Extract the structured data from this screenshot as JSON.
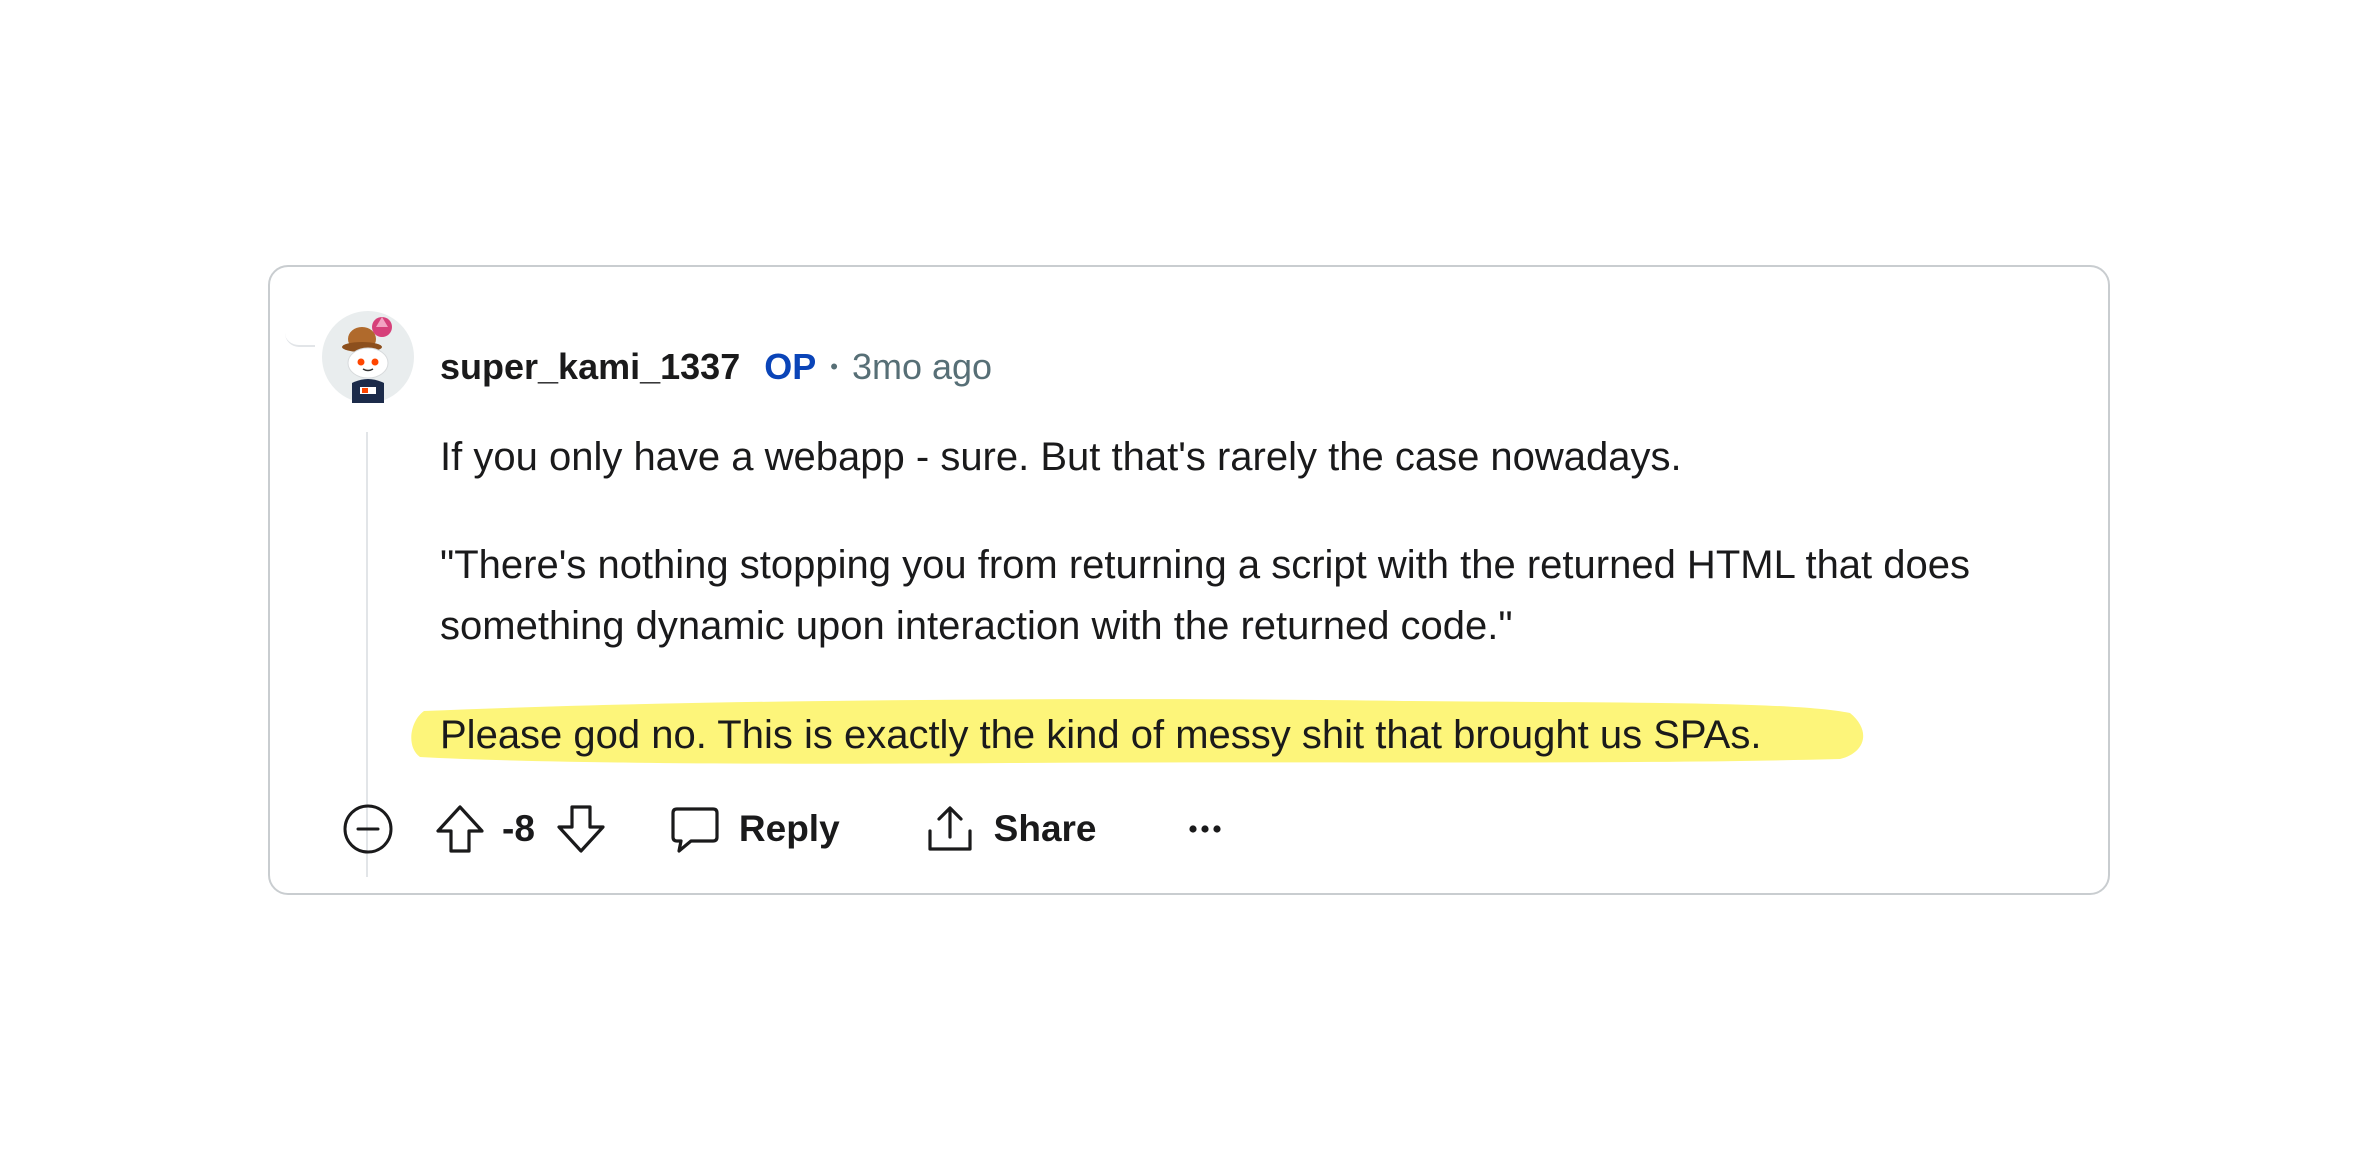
{
  "comment": {
    "username": "super_kami_1337",
    "op_badge": "OP",
    "separator": "•",
    "timestamp": "3mo ago",
    "paragraphs": [
      "If you only have a webapp - sure. But that's rarely the case nowadays.",
      "\"There's nothing stopping you from returning a script with the returned HTML that does something dynamic upon interaction with the returned code.\"",
      "Please god no. This is exactly the kind of messy shit that brought us SPAs."
    ],
    "highlighted_paragraph_index": 2,
    "highlight_color": "#fdf57a"
  },
  "actions": {
    "collapse_icon": "minus-circle-icon",
    "upvote_icon": "arrow-up-icon",
    "score": "-8",
    "downvote_icon": "arrow-down-icon",
    "reply_label": "Reply",
    "reply_icon": "speech-bubble-icon",
    "share_label": "Share",
    "share_icon": "share-upload-icon",
    "more_icon": "ellipsis-icon"
  },
  "colors": {
    "username": "#1a1a1b",
    "op_badge": "#0a44b8",
    "meta_gray": "#576f76",
    "card_border": "#c9cdd0",
    "thread_line": "#e2e5e8"
  }
}
